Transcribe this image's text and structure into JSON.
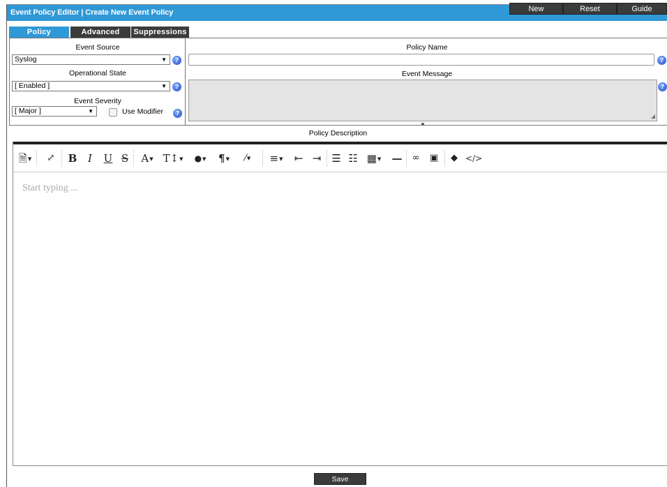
{
  "window": {
    "title": "Event Policy Editor | Create New Event Policy"
  },
  "header_buttons": {
    "new": "New",
    "reset": "Reset",
    "guide": "Guide"
  },
  "tabs": [
    {
      "label": "Policy",
      "active": true
    },
    {
      "label": "Advanced",
      "active": false
    },
    {
      "label": "Suppressions",
      "active": false
    }
  ],
  "form": {
    "event_source": {
      "label": "Event Source",
      "value": "Syslog"
    },
    "operational_state": {
      "label": "Operational State",
      "value": "[ Enabled ]"
    },
    "event_severity": {
      "label": "Event Severity",
      "value": "[ Major ]"
    },
    "use_modifier": {
      "label": "Use Modifier",
      "checked": false
    },
    "policy_name": {
      "label": "Policy Name",
      "value": ""
    },
    "event_message": {
      "label": "Event Message",
      "value": ""
    }
  },
  "description": {
    "label": "Policy Description",
    "placeholder": "Start typing ..."
  },
  "toolbar_icons": [
    "style-icon",
    "fullscreen-icon",
    "bold-icon",
    "italic-icon",
    "underline-icon",
    "strikethrough-icon",
    "font-family-icon",
    "font-size-icon",
    "color-icon",
    "paragraph-icon",
    "magic-style-icon",
    "align-icon",
    "outdent-icon",
    "indent-icon",
    "ordered-list-icon",
    "unordered-list-icon",
    "table-icon",
    "horizontal-rule-icon",
    "link-icon",
    "image-icon",
    "clear-format-icon",
    "code-view-icon"
  ],
  "save_label": "Save",
  "colors": {
    "accent": "#2f98d6",
    "button_dark": "#3b3b3b"
  }
}
